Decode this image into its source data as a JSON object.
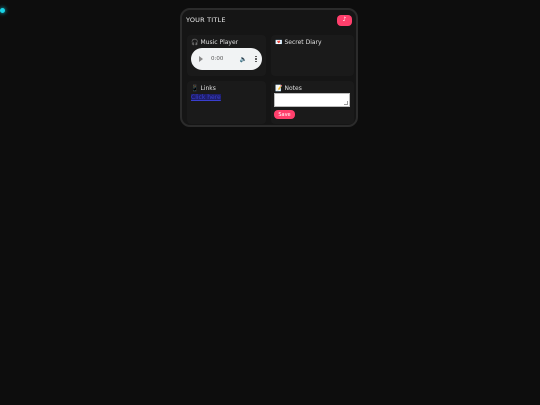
{
  "header": {
    "title": "YOUR TITLE",
    "top_button_icon": "♪"
  },
  "cards": {
    "music": {
      "icon": "🎧",
      "title": "Music Player",
      "time": "0:00"
    },
    "diary": {
      "icon": "💌",
      "title": "Secret Diary"
    },
    "links": {
      "icon": "📱",
      "title": "Links",
      "link_text": "Click here"
    },
    "notes": {
      "icon": "📝",
      "title": "Notes",
      "save_label": "Save"
    }
  },
  "colors": {
    "accent": "#ff3f6c",
    "background": "#0d0d0d",
    "cursor": "#19d3e6"
  }
}
